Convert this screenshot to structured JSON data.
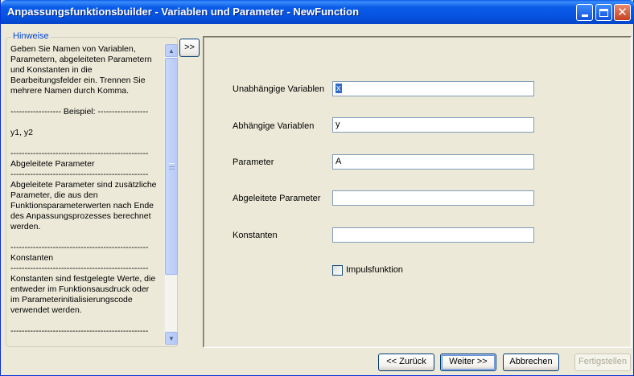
{
  "window": {
    "title": "Anpassungsfunktionsbuilder - Variablen und Parameter - NewFunction",
    "close_glyph": "✕"
  },
  "hints": {
    "legend": "Hinweise",
    "text": "Geben Sie Namen von Variablen,\nParametern, abgeleiteten Parametern\nund Konstanten in die\nBearbeitungsfelder ein. Trennen Sie\nmehrere Namen durch Komma.\n\n------------------ Beispiel: ------------------\n\ny1, y2\n\n-------------------------------------------------\nAbgeleitete Parameter\n-------------------------------------------------\nAbgeleitete Parameter sind zusätzliche\nParameter, die aus den\nFunktionsparameterwerten nach Ende\ndes Anpassungsprozesses berechnet\nwerden.\n\n-------------------------------------------------\nKonstanten\n-------------------------------------------------\nKonstanten sind festgelegte Werte, die\nentweder im Funktionsausdruck oder\nim Parameterinitialisierungscode\nverwendet werden.\n\n-------------------------------------------------",
    "scroll_up_glyph": "▲",
    "scroll_down_glyph": "▼"
  },
  "toggle": {
    "label": ">>"
  },
  "form": {
    "independent": {
      "label": "Unabhängige Variablen",
      "value": "x"
    },
    "dependent": {
      "label": "Abhängige Variablen",
      "value": "y"
    },
    "parameters": {
      "label": "Parameter",
      "value": "A"
    },
    "derived": {
      "label": "Abgeleitete Parameter",
      "value": ""
    },
    "constants": {
      "label": "Konstanten",
      "value": ""
    },
    "impulse": {
      "label": "Impulsfunktion",
      "checked": false
    }
  },
  "buttons": {
    "back": "<< Zurück",
    "next": "Weiter >>",
    "cancel": "Abbrechen",
    "finish": "Fertigstellen"
  }
}
